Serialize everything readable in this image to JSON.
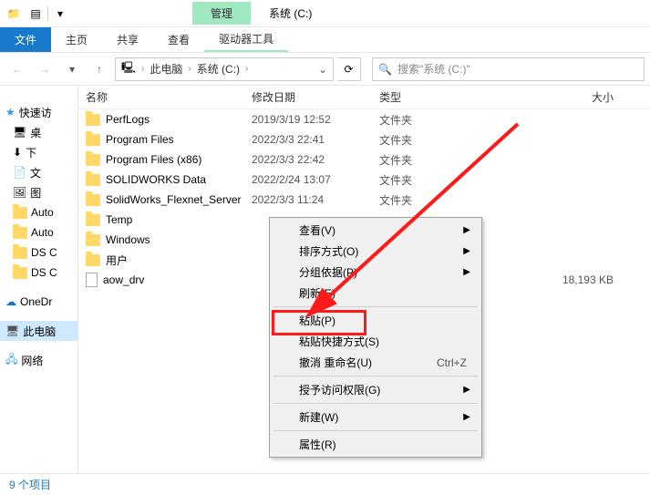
{
  "titlebar": {
    "manage": "管理",
    "window_title": "系统 (C:)"
  },
  "ribbon": {
    "file": "文件",
    "home": "主页",
    "share": "共享",
    "view": "查看",
    "drive_tools": "驱动器工具"
  },
  "address": {
    "this_pc": "此电脑",
    "location": "系统 (C:)"
  },
  "search": {
    "placeholder": "搜索\"系统 (C:)\""
  },
  "sidebar": {
    "quick": "快速访",
    "desktop": "桌",
    "downloads": "下",
    "documents": "文",
    "pictures": "图",
    "autoa": "Auto",
    "autob": "Auto",
    "dsc1": "DS C",
    "dsc2": "DS C",
    "onedrive": "OneDr",
    "this_pc": "此电脑",
    "network": "网络"
  },
  "columns": {
    "name": "名称",
    "date": "修改日期",
    "type": "类型",
    "size": "大小"
  },
  "type_folder": "文件夹",
  "rows": [
    {
      "name": "PerfLogs",
      "date": "2019/3/19 12:52",
      "type": "文件夹",
      "icon": "folder",
      "size": ""
    },
    {
      "name": "Program Files",
      "date": "2022/3/3 22:41",
      "type": "文件夹",
      "icon": "folder",
      "size": ""
    },
    {
      "name": "Program Files (x86)",
      "date": "2022/3/3 22:42",
      "type": "文件夹",
      "icon": "folder",
      "size": ""
    },
    {
      "name": "SOLIDWORKS Data",
      "date": "2022/2/24 13:07",
      "type": "文件夹",
      "icon": "folder",
      "size": ""
    },
    {
      "name": "SolidWorks_Flexnet_Server",
      "date": "2022/3/3 11:24",
      "type": "文件夹",
      "icon": "folder",
      "size": ""
    },
    {
      "name": "Temp",
      "date": "",
      "type": "",
      "icon": "folder",
      "size": ""
    },
    {
      "name": "Windows",
      "date": "",
      "type": "",
      "icon": "folder",
      "size": ""
    },
    {
      "name": "用户",
      "date": "",
      "type": "",
      "icon": "folder",
      "size": ""
    },
    {
      "name": "aow_drv",
      "date": "",
      "type": "",
      "icon": "file",
      "size": "18,193 KB"
    }
  ],
  "menu": {
    "view": "查看(V)",
    "sort": "排序方式(O)",
    "group": "分组依据(P)",
    "refresh": "刷新(E)",
    "paste": "粘贴(P)",
    "paste_shortcut": "粘贴快捷方式(S)",
    "undo_rename": "撤消 重命名(U)",
    "undo_key": "Ctrl+Z",
    "access": "授予访问权限(G)",
    "new": "新建(W)",
    "properties": "属性(R)"
  },
  "status": {
    "items": "9 个项目"
  }
}
